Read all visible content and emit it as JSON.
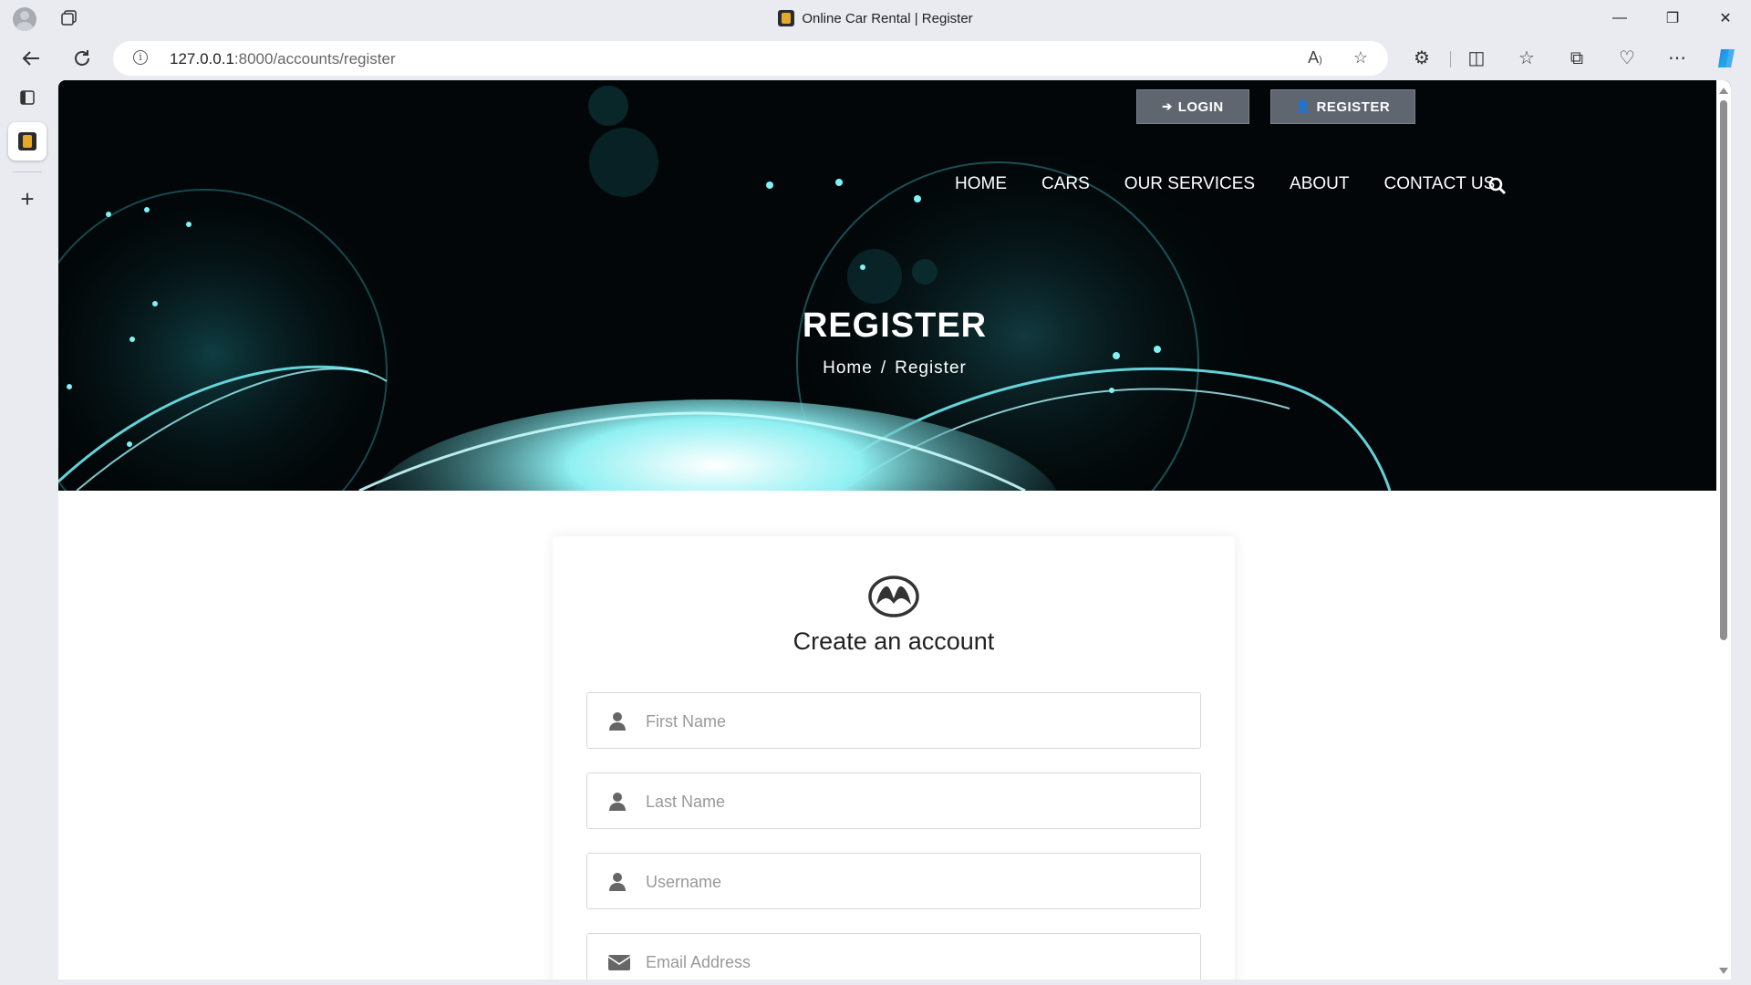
{
  "browser": {
    "tab_title": "Online Car Rental | Register",
    "url_host": "127.0.0.1",
    "url_path": ":8000/accounts/register",
    "window_controls": {
      "minimize": "—",
      "restore": "❐",
      "close": "✕"
    }
  },
  "site": {
    "top_buttons": {
      "login": "LOGIN",
      "register": "REGISTER"
    },
    "nav": [
      "HOME",
      "CARS",
      "OUR SERVICES",
      "ABOUT",
      "CONTACT US"
    ],
    "hero_title": "REGISTER",
    "breadcrumb": {
      "home": "Home",
      "separator": "/",
      "current": "Register"
    }
  },
  "form": {
    "heading": "Create an account",
    "fields": {
      "first_name": {
        "placeholder": "First Name",
        "icon": "user-icon"
      },
      "last_name": {
        "placeholder": "Last Name",
        "icon": "user-icon"
      },
      "username": {
        "placeholder": "Username",
        "icon": "user-icon"
      },
      "email": {
        "placeholder": "Email Address",
        "icon": "envelope-icon"
      }
    }
  },
  "colors": {
    "hero_bg": "#000000",
    "hero_glow": "#3fd6e0",
    "button_bg": "#5f6670",
    "browser_chrome": "#e9ebf0"
  }
}
